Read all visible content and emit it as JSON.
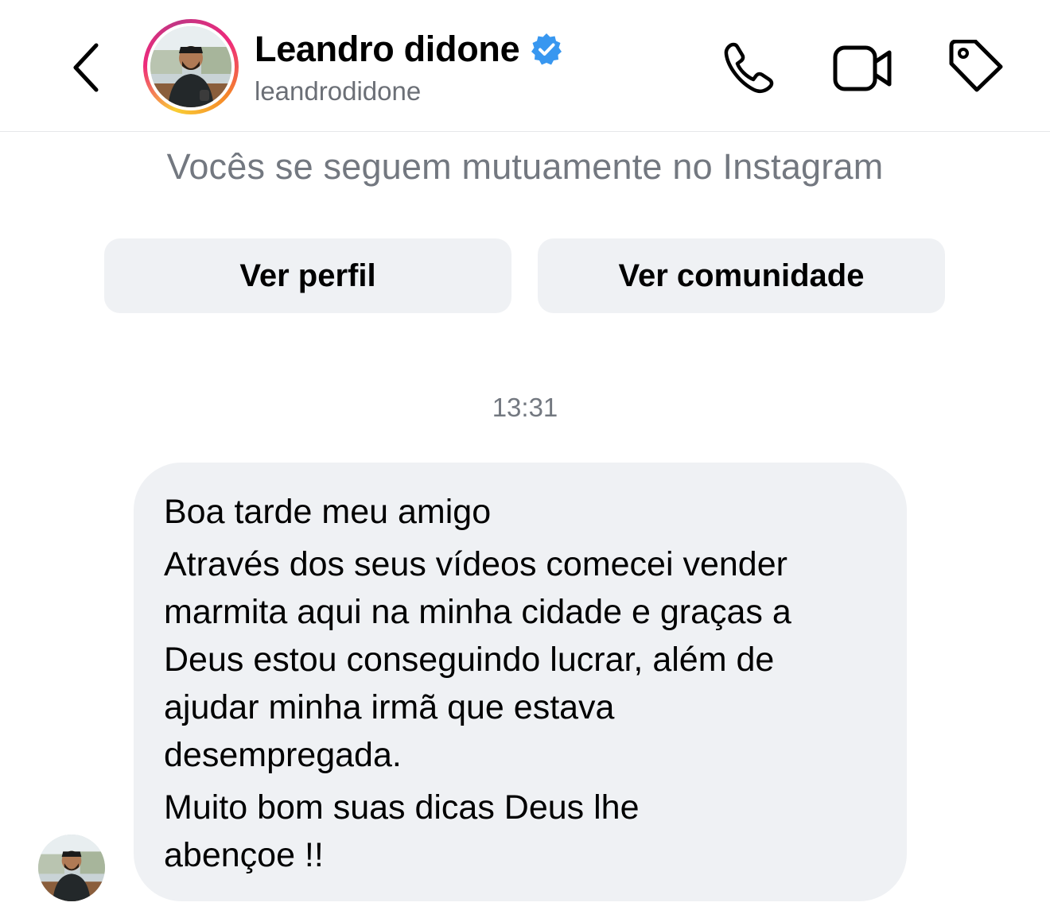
{
  "header": {
    "display_name": "Leandro didone",
    "username": "leandrodidone",
    "verified": true,
    "icons": {
      "back": "chevron-left-icon",
      "call": "phone-icon",
      "video": "video-camera-icon",
      "tag": "tag-icon"
    }
  },
  "mutual_follow_text": "Vocês se seguem mutuamente no Instagram",
  "buttons": {
    "view_profile": "Ver perfil",
    "view_community": "Ver comunidade"
  },
  "conversation": {
    "timestamp": "13:31",
    "message": {
      "lines": [
        "Boa tarde meu amigo",
        "Através dos seus vídeos comecei vender",
        "marmita aqui na minha cidade e graças a",
        "Deus estou conseguindo lucrar, além de",
        "ajudar minha irmã que estava",
        "desempregada.",
        "Muito bom suas dicas Deus lhe",
        "abençoe !!"
      ]
    }
  },
  "colors": {
    "bubble_bg": "#eff1f4",
    "secondary_text": "#737880",
    "verified_blue": "#3897f0"
  }
}
